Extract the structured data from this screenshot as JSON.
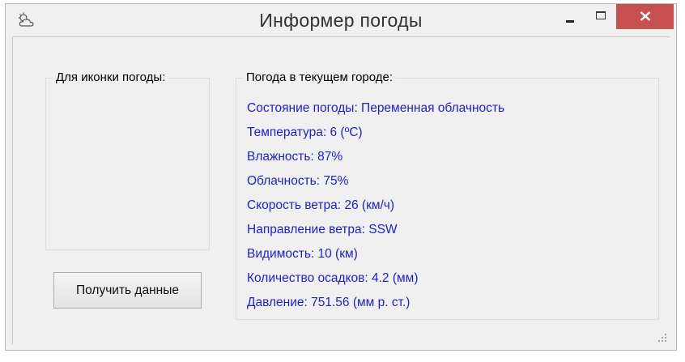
{
  "window": {
    "title": "Информер погоды",
    "app_icon": "cloud-weather-icon",
    "controls": {
      "minimize": "minimize-icon",
      "maximize": "maximize-icon",
      "close": "close-icon"
    },
    "close_color": "#c75050"
  },
  "icon_group": {
    "legend": "Для иконки погоды:"
  },
  "weather_group": {
    "legend": "Погода в текущем городе:",
    "items": [
      "Состояние погоды: Переменная облачность",
      "Температура: 6 (ºC)",
      "Влажность: 87%",
      "Облачность: 75%",
      "Скорость ветра: 26 (км/ч)",
      "Направление ветра: SSW",
      "Видимость: 10 (км)",
      "Количество осадков: 4.2 (мм)",
      "Давление: 751.56 (мм р. ст.)"
    ],
    "text_color": "#1f21c8"
  },
  "get_data_button": {
    "label": "Получить данные"
  }
}
